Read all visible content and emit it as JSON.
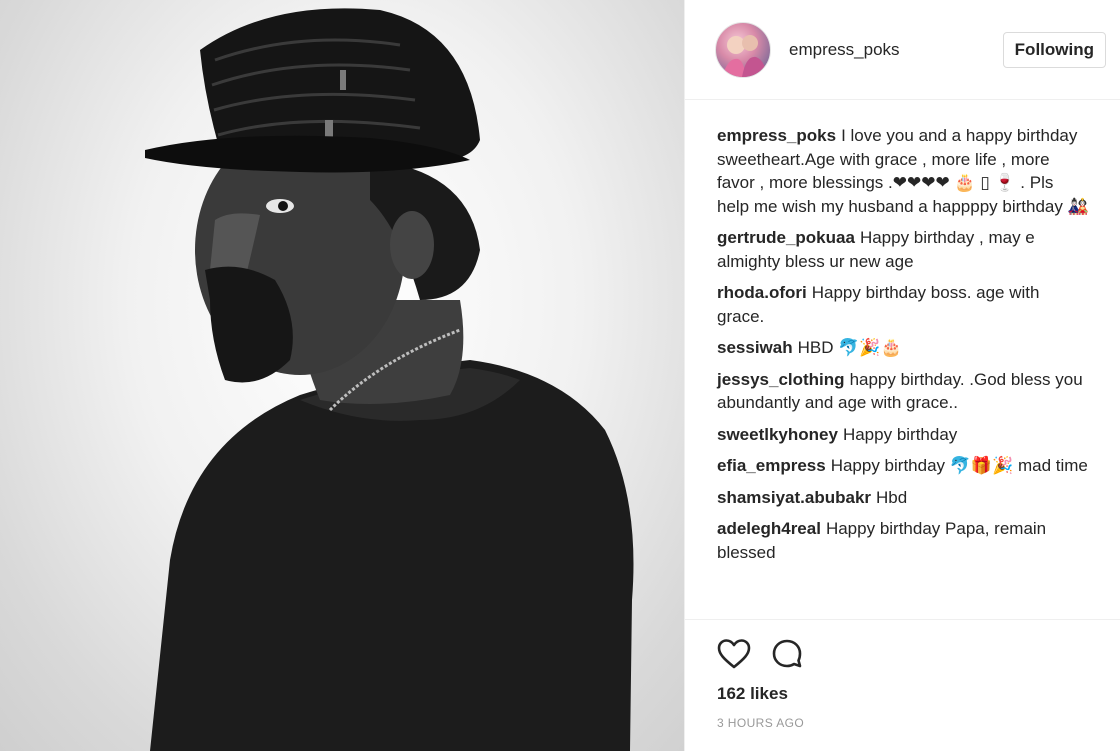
{
  "header": {
    "username": "empress_poks",
    "follow_label": "Following"
  },
  "comments": [
    {
      "user": "empress_poks",
      "text": "I love you and a happy birthday sweetheart.Age with grace , more life , more favor , more blessings .❤❤❤❤ 🎂 ▯ 🍷 . Pls help me wish my husband a happppy birthday 🎎"
    },
    {
      "user": "gertrude_pokuaa",
      "text": "Happy birthday , may e almighty bless ur new age"
    },
    {
      "user": "rhoda.ofori",
      "text": "Happy birthday boss. age with grace."
    },
    {
      "user": "sessiwah",
      "text": "HBD 🐬🎉🎂"
    },
    {
      "user": "jessys_clothing",
      "text": "happy birthday. .God bless you abundantly and age with grace.."
    },
    {
      "user": "sweetlkyhoney",
      "text": "Happy birthday"
    },
    {
      "user": "efia_empress",
      "text": "Happy birthday 🐬🎁🎉 mad time"
    },
    {
      "user": "shamsiyat.abubakr",
      "text": "Hbd"
    },
    {
      "user": "adelegh4real",
      "text": "Happy birthday Papa, remain blessed"
    }
  ],
  "likes_label": "162 likes",
  "timestamp": "3 HOURS AGO",
  "icons": {
    "like": "heart-icon",
    "comment": "comment-bubble-icon"
  }
}
